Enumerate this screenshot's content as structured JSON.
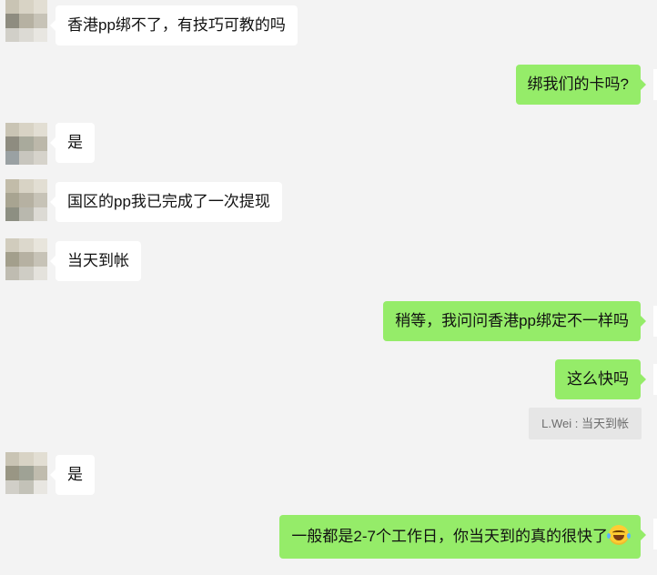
{
  "messages": [
    {
      "side": "in",
      "text": "香港pp绑不了，有技巧可教的吗"
    },
    {
      "side": "out",
      "text": "绑我们的卡吗?"
    },
    {
      "side": "in",
      "text": "是"
    },
    {
      "side": "in",
      "text": "国区的pp我已完成了一次提现"
    },
    {
      "side": "in",
      "text": "当天到帐"
    },
    {
      "side": "out",
      "text": "稍等，我问问香港pp绑定不一样吗"
    },
    {
      "side": "out",
      "text": "这么快吗"
    },
    {
      "side": "in",
      "text": "是"
    },
    {
      "side": "out",
      "text": "一般都是2-7个工作日，你当天到的真的很快了",
      "emoji": "tears-of-joy"
    }
  ],
  "quote": {
    "text": "L.Wei : 当天到帐"
  },
  "colors": {
    "outgoing_bubble": "#95ec69",
    "incoming_bubble": "#ffffff",
    "background": "#f3f3f3",
    "quote_bg": "#e6e6e6"
  }
}
